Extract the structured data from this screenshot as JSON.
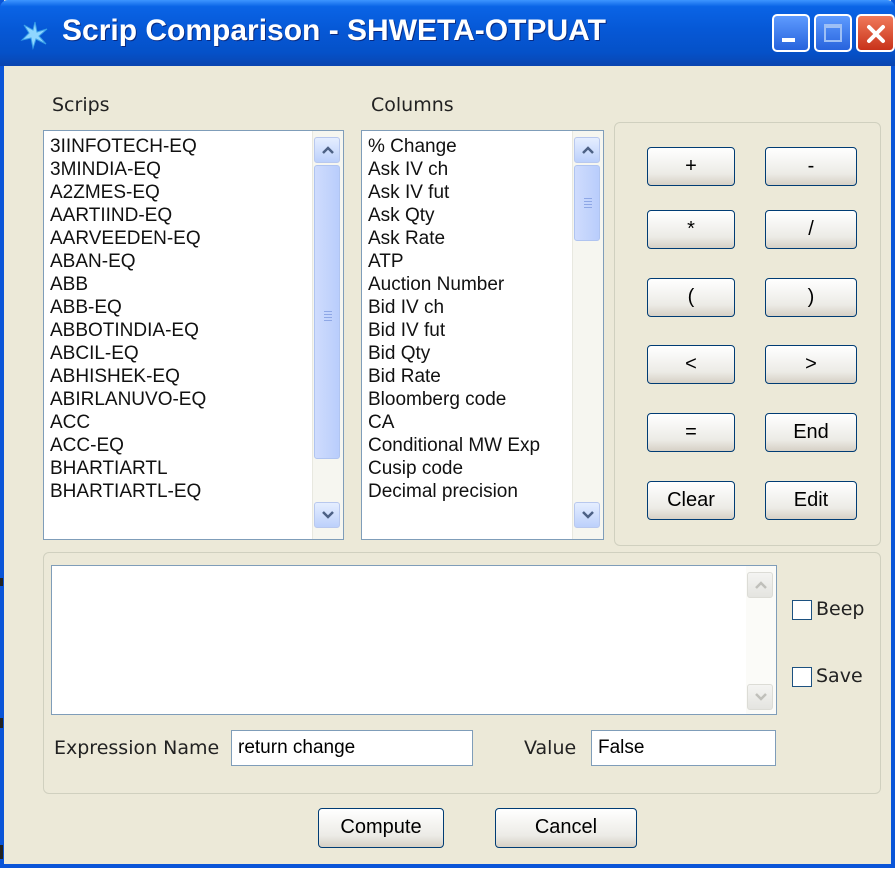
{
  "window": {
    "title": "Scrip Comparison - SHWETA-OTPUAT"
  },
  "scrips": {
    "label": "Scrips",
    "items": [
      "3IINFOTECH-EQ",
      "3MINDIA-EQ",
      "A2ZMES-EQ",
      "AARTIIND-EQ",
      "AARVEEDEN-EQ",
      "ABAN-EQ",
      "ABB",
      "ABB-EQ",
      "ABBOTINDIA-EQ",
      "ABCIL-EQ",
      "ABHISHEK-EQ",
      "ABIRLANUVO-EQ",
      "ACC",
      "ACC-EQ",
      "BHARTIARTL",
      "BHARTIARTL-EQ"
    ]
  },
  "columns": {
    "label": "Columns",
    "items": [
      "% Change",
      "Ask IV ch",
      "Ask IV fut",
      "Ask Qty",
      "Ask Rate",
      "ATP",
      "Auction Number",
      "Bid IV ch",
      "Bid IV fut",
      "Bid Qty",
      "Bid Rate",
      "Bloomberg code",
      "CA",
      "Conditional MW Exp",
      "Cusip code",
      "Decimal precision"
    ]
  },
  "operators": {
    "plus": "+",
    "minus": "-",
    "multiply": "*",
    "divide": "/",
    "lparen": "(",
    "rparen": ")",
    "lt": "<",
    "gt": ">",
    "eq": "=",
    "end": "End",
    "clear": "Clear",
    "edit": "Edit"
  },
  "options": {
    "beep": "Beep",
    "save": "Save"
  },
  "expression": {
    "name_label": "Expression Name",
    "name_value": "return change",
    "value_label": "Value",
    "value_value": "False"
  },
  "actions": {
    "compute": "Compute",
    "cancel": "Cancel"
  }
}
